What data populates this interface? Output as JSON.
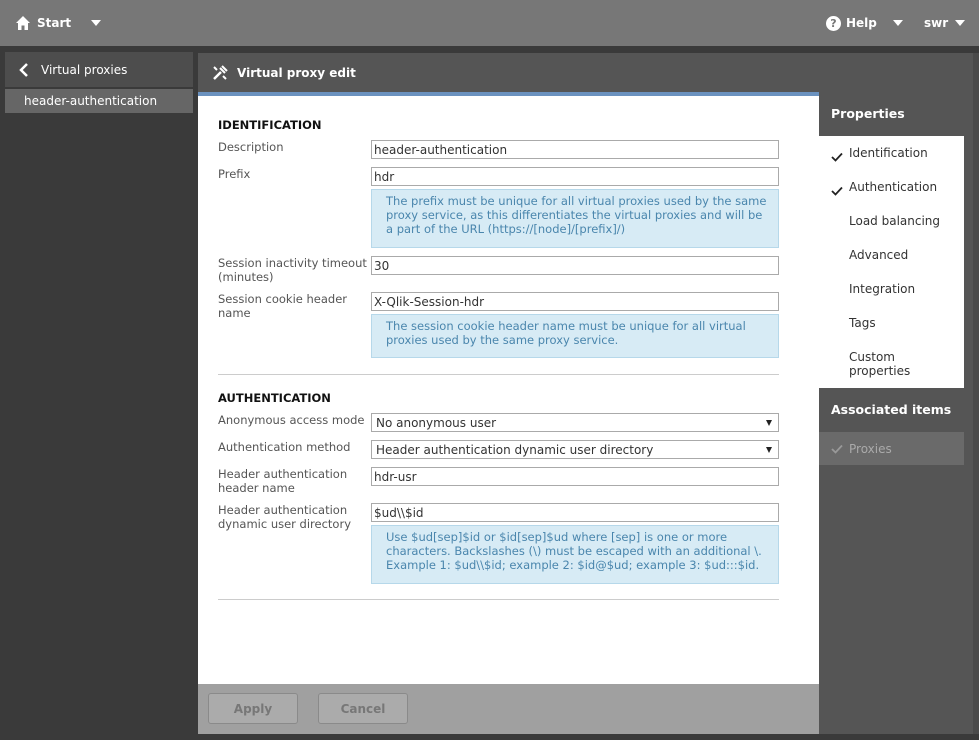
{
  "topbar": {
    "start": "Start",
    "help": "Help",
    "user": "swr"
  },
  "sidebar": {
    "back_label": "Virtual proxies",
    "selected_label": "header-authentication"
  },
  "main": {
    "title": "Virtual proxy edit",
    "identification": {
      "section_title": "IDENTIFICATION",
      "description_label": "Description",
      "description_value": "header-authentication",
      "prefix_label": "Prefix",
      "prefix_value": "hdr",
      "prefix_hint": "The prefix must be unique for all virtual proxies used by the same proxy service, as this differentiates the virtual proxies and will be a part of the URL (https://[node]/[prefix]/)",
      "timeout_label": "Session inactivity timeout (minutes)",
      "timeout_value": "30",
      "cookie_label": "Session cookie header name",
      "cookie_value": "X-Qlik-Session-hdr",
      "cookie_hint": "The session cookie header name must be unique for all virtual proxies used by the same proxy service."
    },
    "authentication": {
      "section_title": "AUTHENTICATION",
      "anon_label": "Anonymous access mode",
      "anon_value": "No anonymous user",
      "method_label": "Authentication method",
      "method_value": "Header authentication dynamic user directory",
      "header_name_label": "Header authentication header name",
      "header_name_value": "hdr-usr",
      "dyn_dir_label": "Header authentication dynamic user directory",
      "dyn_dir_value": "$ud\\\\$id",
      "dyn_dir_hint": "Use $ud[sep]$id or $id[sep]$ud where [sep] is one or more characters. Backslashes (\\) must be escaped with an additional \\. Example 1: $ud\\\\$id; example 2: $id@$ud; example 3: $ud:::$id."
    },
    "buttons": {
      "apply": "Apply",
      "cancel": "Cancel"
    }
  },
  "properties": {
    "title": "Properties",
    "items": [
      {
        "label": "Identification",
        "checked": true
      },
      {
        "label": "Authentication",
        "checked": true
      },
      {
        "label": "Load balancing",
        "checked": false
      },
      {
        "label": "Advanced",
        "checked": false
      },
      {
        "label": "Integration",
        "checked": false
      },
      {
        "label": "Tags",
        "checked": false
      },
      {
        "label": "Custom properties",
        "checked": false
      }
    ],
    "associated_title": "Associated items",
    "associated_items": [
      {
        "label": "Proxies",
        "checked": true
      }
    ]
  },
  "colors": {
    "topbar": "#777777",
    "header": "#555555",
    "accent": "#6b92bf",
    "hint_bg": "#d7ebf5",
    "hint_text": "#4a86ad"
  }
}
